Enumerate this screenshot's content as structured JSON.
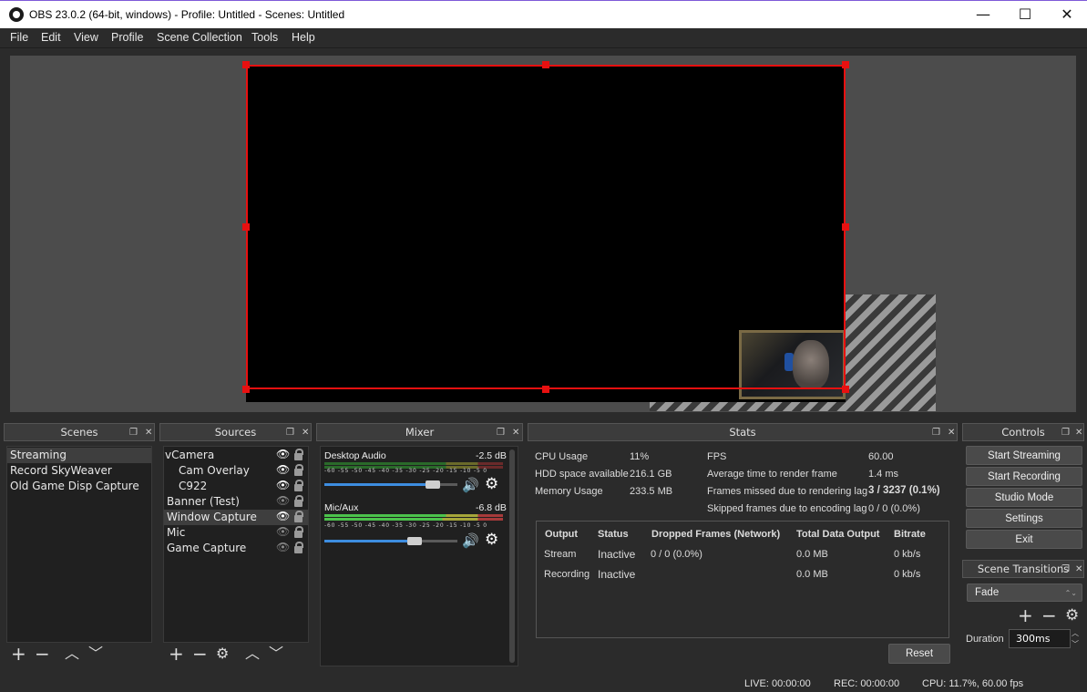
{
  "window": {
    "title": "OBS 23.0.2 (64-bit, windows) - Profile: Untitled - Scenes: Untitled",
    "minimize": "—",
    "maximize": "☐",
    "close": "✕"
  },
  "menu": [
    "File",
    "Edit",
    "View",
    "Profile",
    "Scene Collection",
    "Tools",
    "Help"
  ],
  "docks": {
    "scenes": "Scenes",
    "sources": "Sources",
    "mixer": "Mixer",
    "stats": "Stats",
    "controls": "Controls",
    "transitions": "Scene Transitions"
  },
  "scenes": [
    "Streaming",
    "Record SkyWeaver",
    "Old Game Disp Capture"
  ],
  "sources": [
    {
      "label": "Camera",
      "prefix": "v"
    },
    {
      "label": "Cam Overlay"
    },
    {
      "label": "C922"
    },
    {
      "label": "Banner (Test)"
    },
    {
      "label": "Window Capture"
    },
    {
      "label": "Mic"
    },
    {
      "label": "Game Capture"
    }
  ],
  "mixer": {
    "tracks": [
      {
        "name": "Desktop Audio",
        "db": "-2.5 dB",
        "level": 0.85
      },
      {
        "name": "Mic/Aux",
        "db": "-6.8 dB",
        "level": 0.7
      }
    ],
    "scale": "-60 -55 -50 -45 -40 -35 -30 -25 -20 -15 -10 -5 0"
  },
  "stats": {
    "left": [
      {
        "label": "CPU Usage",
        "value": "11%"
      },
      {
        "label": "HDD space available",
        "value": "216.1 GB"
      },
      {
        "label": "Memory Usage",
        "value": "233.5 MB"
      }
    ],
    "right": [
      {
        "label": "FPS",
        "value": "60.00"
      },
      {
        "label": "Average time to render frame",
        "value": "1.4 ms"
      },
      {
        "label": "Frames missed due to rendering lag",
        "value": "3 / 3237 (0.1%)"
      },
      {
        "label": "Skipped frames due to encoding lag",
        "value": "0 / 0 (0.0%)"
      }
    ],
    "table_headers": [
      "Output",
      "Status",
      "Dropped Frames (Network)",
      "Total Data Output",
      "Bitrate"
    ],
    "table_rows": [
      [
        "Stream",
        "Inactive",
        "0 / 0 (0.0%)",
        "0.0 MB",
        "0 kb/s"
      ],
      [
        "Recording",
        "Inactive",
        "",
        "0.0 MB",
        "0 kb/s"
      ]
    ],
    "reset": "Reset"
  },
  "controls": [
    "Start Streaming",
    "Start Recording",
    "Studio Mode",
    "Settings",
    "Exit"
  ],
  "transitions": {
    "selected": "Fade",
    "duration_label": "Duration",
    "duration_value": "300ms"
  },
  "statusbar": {
    "live": "LIVE: 00:00:00",
    "rec": "REC: 00:00:00",
    "cpu": "CPU: 11.7%, 60.00 fps"
  },
  "colors": {
    "selection": "#e81010",
    "meter_green": "#4cc34c",
    "slider_blue": "#3d8de0"
  }
}
